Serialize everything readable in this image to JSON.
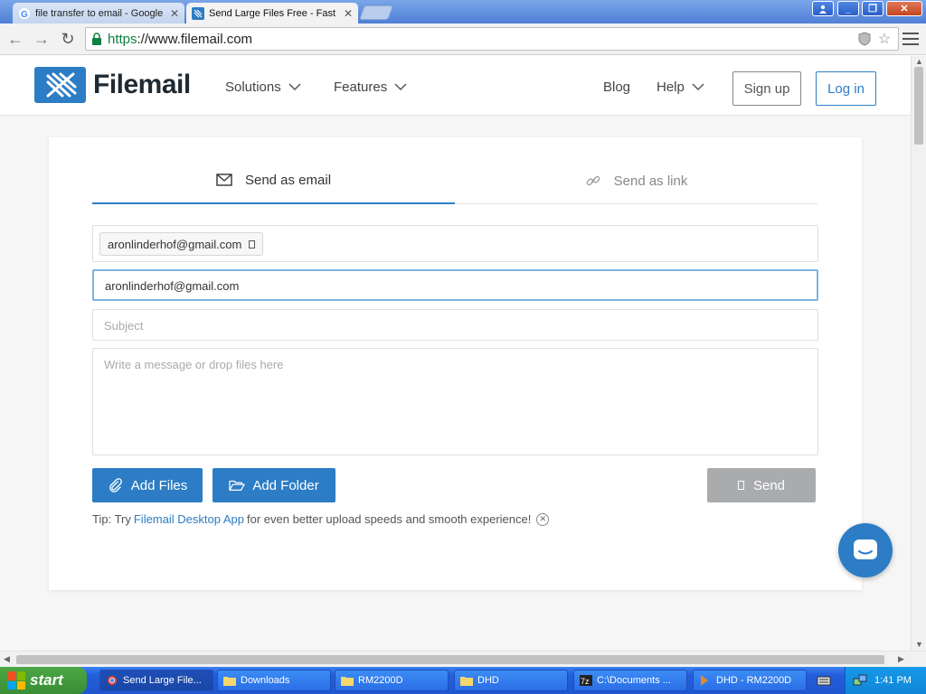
{
  "browser": {
    "tabs": [
      {
        "title": "file transfer to email - Google",
        "active": false
      },
      {
        "title": "Send Large Files Free - Fast",
        "active": true
      }
    ],
    "url_scheme": "https",
    "url_rest": "://www.filemail.com"
  },
  "site": {
    "logo_text": "Filemail",
    "nav": {
      "solutions": "Solutions",
      "features": "Features",
      "blog": "Blog",
      "help": "Help"
    },
    "signup_label": "Sign up",
    "login_label": "Log in"
  },
  "form": {
    "tab_email": "Send as email",
    "tab_link": "Send as link",
    "recipient_chip": "aronlinderhof@gmail.com",
    "from_value": "aronlinderhof@gmail.com",
    "subject_placeholder": "Subject",
    "message_placeholder": "Write a message or drop files here",
    "add_files_label": "Add Files",
    "add_folder_label": "Add Folder",
    "send_label": "Send",
    "tip_prefix": "Tip: Try",
    "tip_link": "Filemail Desktop App",
    "tip_suffix": "for even better upload speeds and smooth experience!"
  },
  "taskbar": {
    "start_label": "start",
    "items": [
      "Send Large File...",
      "Downloads",
      "RM2200D",
      "DHD",
      "C:\\Documents ...",
      "DHD - RM2200D"
    ],
    "clock": "1:41 PM"
  },
  "colors": {
    "brand": "#2c7dc5",
    "send_disabled": "#a9abad"
  }
}
